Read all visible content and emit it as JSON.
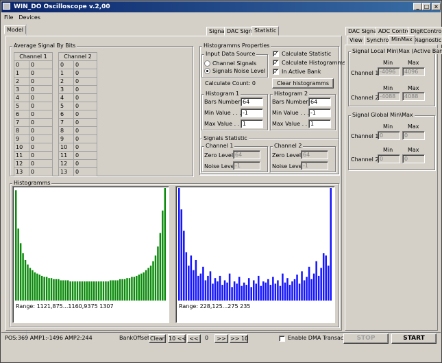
{
  "window": {
    "title": "WIN_DO Oscilloscope v.2,00"
  },
  "title_buttons": {
    "minimize": "_",
    "maximize": "□",
    "close": "×"
  },
  "menu": [
    "File",
    "Devices"
  ],
  "left_tabs": [
    "Model"
  ],
  "center_tabs": [
    "Signal",
    "DAC Signal",
    "Statistic"
  ],
  "right_tabs_row1": [
    "DAC Signal",
    "ADC Control",
    "DigitControl"
  ],
  "right_tabs_row2": [
    "View",
    "Synchro",
    "MinMax",
    "Diagnostic"
  ],
  "avg_signal": {
    "title": "Average Signal By Bits",
    "ch1_label": "Channel 1",
    "ch2_label": "Channel 2",
    "ch1_rows": [
      [
        "0",
        "0"
      ],
      [
        "1",
        "0"
      ],
      [
        "2",
        "0"
      ],
      [
        "3",
        "0"
      ],
      [
        "4",
        "0"
      ],
      [
        "5",
        "0"
      ],
      [
        "6",
        "0"
      ],
      [
        "7",
        "0"
      ],
      [
        "8",
        "0"
      ],
      [
        "9",
        "0"
      ],
      [
        "10",
        "0"
      ],
      [
        "11",
        "0"
      ],
      [
        "12",
        "0"
      ],
      [
        "13",
        "0"
      ]
    ],
    "ch2_rows": [
      [
        "0",
        "0"
      ],
      [
        "1",
        "0"
      ],
      [
        "2",
        "0"
      ],
      [
        "3",
        "0"
      ],
      [
        "4",
        "0"
      ],
      [
        "5",
        "0"
      ],
      [
        "6",
        "0"
      ],
      [
        "7",
        "0"
      ],
      [
        "8",
        "0"
      ],
      [
        "9",
        "0"
      ],
      [
        "10",
        "0"
      ],
      [
        "11",
        "0"
      ],
      [
        "12",
        "0"
      ],
      [
        "13",
        "0"
      ]
    ]
  },
  "hist_props": {
    "title": "Histogramms Properties",
    "input_source": {
      "title": "Input Data Source",
      "opt1": "Channel Signals",
      "opt2": "Signals Noise Level",
      "selected": 2
    },
    "calc_count": "Calculate Count: 0",
    "calc_statistic": "Calculate Statistic",
    "calc_histograms": "Calculate Histogramms",
    "in_active_bank": "In Active Bank",
    "check_mark": "✓",
    "clear_button": "Clear histogramms",
    "hist1": {
      "title": "Histogram 1",
      "bars_label": "Bars Number . . .",
      "bars": "64",
      "min_label": "Min Value . . . . .",
      "min": "-1",
      "max_label": "Max Value . . . . .",
      "max": "1"
    },
    "hist2": {
      "title": "Histogram 2",
      "bars_label": "Bars Number . . .",
      "bars": "64",
      "min_label": "Min Value . . . . .",
      "min": "-1",
      "max_label": "Max Value . . . . .",
      "max": "1"
    }
  },
  "signals_stat": {
    "title": "Signals Statistic",
    "ch1": {
      "title": "Channel 1",
      "zero_label": "Zero Level . . .",
      "zero": "64",
      "noise_label": "Noise Level . .",
      "noise": "-1"
    },
    "ch2": {
      "title": "Channel 2",
      "zero_label": "Zero Level . . .",
      "zero": "64",
      "noise_label": "Noise Level . .",
      "noise": "-1"
    }
  },
  "histograms": {
    "title": "Histogramms",
    "range1": "Range:  1121,875...1160,9375   1307",
    "range2": "Range:  228,125...275   235",
    "color1": "#0a8a0a",
    "color2": "#1414ff"
  },
  "chart_data": [
    {
      "type": "bar",
      "title": "",
      "values": [
        98,
        64,
        51,
        42,
        36,
        32,
        29,
        27,
        25,
        24,
        23,
        22,
        21,
        21,
        20,
        20,
        19,
        19,
        19,
        18,
        18,
        18,
        18,
        17,
        17,
        17,
        17,
        17,
        17,
        17,
        17,
        17,
        17,
        17,
        17,
        17,
        17,
        17,
        17,
        17,
        18,
        18,
        18,
        18,
        19,
        19,
        19,
        20,
        20,
        21,
        21,
        22,
        23,
        24,
        25,
        27,
        29,
        31,
        35,
        40,
        48,
        60,
        80,
        100
      ],
      "ylim": [
        0,
        100
      ]
    },
    {
      "type": "bar",
      "title": "",
      "values": [
        100,
        81,
        62,
        43,
        31,
        40,
        27,
        36,
        22,
        24,
        30,
        18,
        22,
        26,
        15,
        20,
        17,
        22,
        14,
        18,
        16,
        24,
        12,
        17,
        15,
        21,
        13,
        16,
        14,
        20,
        12,
        18,
        15,
        22,
        13,
        17,
        16,
        19,
        14,
        21,
        15,
        18,
        13,
        24,
        16,
        20,
        14,
        17,
        19,
        23,
        15,
        26,
        18,
        21,
        30,
        19,
        24,
        35,
        22,
        29,
        42,
        40,
        31,
        100
      ],
      "ylim": [
        0,
        100
      ]
    }
  ],
  "right_panel": {
    "local": {
      "title": "Signal Local Min\\Max (Active Bank)",
      "min_label": "Min",
      "max_label": "Max",
      "ch1_label": "Channel 1",
      "ch1_min": "-4096",
      "ch1_max": "4096",
      "ch2_label": "Channel 2",
      "ch2_min": "-4088",
      "ch2_max": "4088"
    },
    "global": {
      "title": "Signal Global Min\\Max",
      "min_label": "Min",
      "max_label": "Max",
      "ch1_label": "Channel 1",
      "ch1_min": "0",
      "ch1_max": "0",
      "ch2_label": "Channel 2",
      "ch2_min": "0",
      "ch2_max": "0"
    }
  },
  "status": {
    "pos": "POS:369  AMP1:-1496  AMP2:244",
    "bank_offset": "BankOffset",
    "clear": "Clear",
    "b10back": "10 <<",
    "bback": "<<",
    "value": "0",
    "bfwd": ">>",
    "b10fwd": ">> 10",
    "dma_label": "Enable DMA Transaction",
    "stop": "STOP",
    "start": "START"
  }
}
